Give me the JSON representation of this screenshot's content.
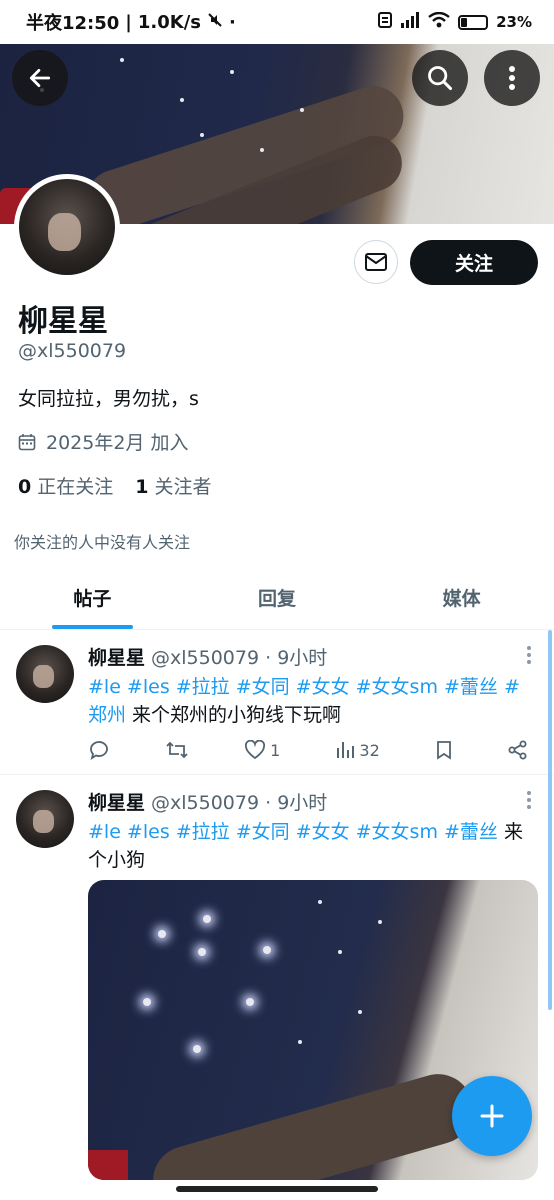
{
  "status_bar": {
    "time": "半夜12:50",
    "speed": "1.0K/s",
    "battery": "23%"
  },
  "profile": {
    "name": "柳星星",
    "handle": "@xl550079",
    "bio": "女同拉拉，男勿扰，s",
    "joined": "2025年2月 加入",
    "following_count": "0",
    "following_label": "正在关注",
    "followers_count": "1",
    "followers_label": "关注者",
    "mutual_note": "你关注的人中没有人关注",
    "follow_button": "关注"
  },
  "tabs": [
    {
      "label": "帖子",
      "active": true
    },
    {
      "label": "回复",
      "active": false
    },
    {
      "label": "媒体",
      "active": false
    }
  ],
  "posts": [
    {
      "author": "柳星星",
      "meta": "@xl550079 · 9小时",
      "tags_line1": "#le #les #拉拉 #女同  #女女 #女女sm #蕾丝  #",
      "tags_line2": "郑州",
      "text": " 来个郑州的小狗线下玩啊",
      "replies": "",
      "reposts": "",
      "likes": "1",
      "views": "32"
    },
    {
      "author": "柳星星",
      "meta": "@xl550079 · 9小时",
      "tags_line1": "#le #les #拉拉 #女同  #女女 #女女sm #蕾丝",
      "text_line1": " 来",
      "text_line2": "个小狗"
    }
  ],
  "colors": {
    "accent": "#1d9bf0",
    "text": "#0f1419",
    "secondary": "#536471"
  }
}
